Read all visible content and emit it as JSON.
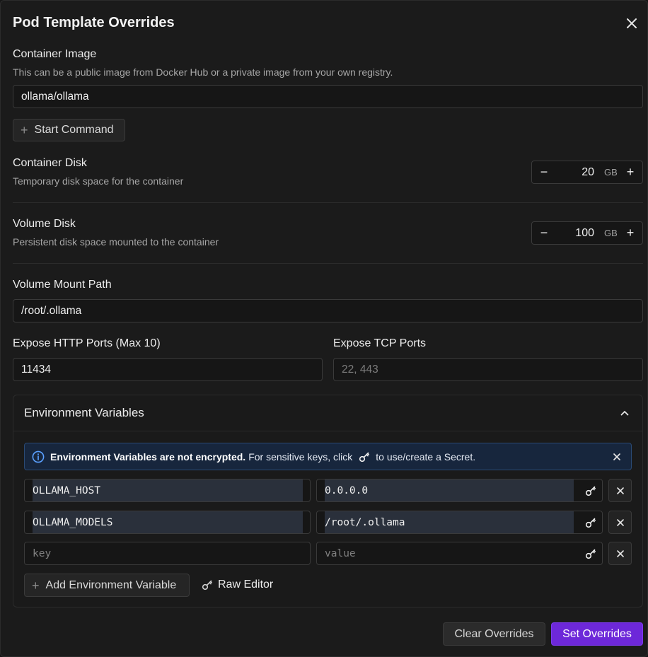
{
  "dialog": {
    "title": "Pod Template Overrides",
    "close_icon": "close-icon"
  },
  "container_image": {
    "label": "Container Image",
    "help": "This can be a public image from Docker Hub or a private image from your own registry.",
    "value": "ollama/ollama"
  },
  "start_command": {
    "label": "Start Command"
  },
  "container_disk": {
    "label": "Container Disk",
    "help": "Temporary disk space for the container",
    "value": "20",
    "unit": "GB"
  },
  "volume_disk": {
    "label": "Volume Disk",
    "help": "Persistent disk space mounted to the container",
    "value": "100",
    "unit": "GB"
  },
  "volume_mount": {
    "label": "Volume Mount Path",
    "value": "/root/.ollama"
  },
  "http_ports": {
    "label": "Expose HTTP Ports (Max 10)",
    "value": "11434"
  },
  "tcp_ports": {
    "label": "Expose TCP Ports",
    "placeholder": "22, 443"
  },
  "env": {
    "title": "Environment Variables",
    "notice_bold": "Environment Variables are not encrypted.",
    "notice_text": "For sensitive keys, click",
    "notice_tail": "to use/create a Secret.",
    "rows": [
      {
        "key": "OLLAMA_HOST",
        "value": "0.0.0.0"
      },
      {
        "key": "OLLAMA_MODELS",
        "value": "/root/.ollama"
      }
    ],
    "new_row": {
      "key_placeholder": "key",
      "value_placeholder": "value"
    },
    "add_label": "Add Environment Variable",
    "raw_editor_label": "Raw Editor"
  },
  "footer": {
    "clear_label": "Clear Overrides",
    "set_label": "Set Overrides"
  },
  "colors": {
    "accent": "#6d28d9",
    "notice_bg": "#17263d",
    "notice_border": "#2a4a75"
  }
}
